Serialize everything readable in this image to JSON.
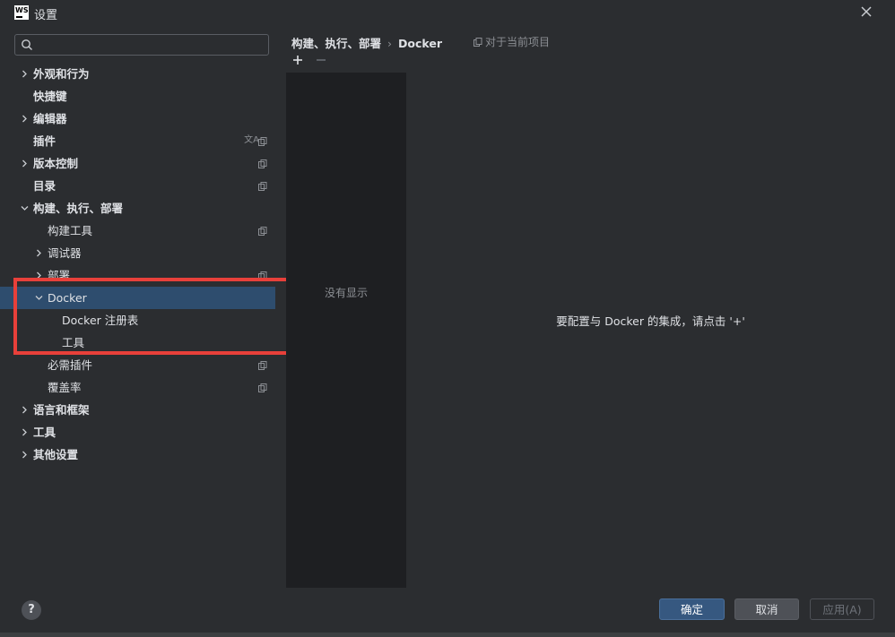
{
  "window": {
    "title": "设置",
    "logo_text": "WS"
  },
  "search": {
    "placeholder": "",
    "value": ""
  },
  "tree": [
    {
      "label": "外观和行为",
      "bold": true,
      "chevron": "right",
      "indent": 0,
      "icons": []
    },
    {
      "label": "快捷键",
      "bold": true,
      "chevron": "none",
      "indent": 0,
      "icons": []
    },
    {
      "label": "编辑器",
      "bold": true,
      "chevron": "right",
      "indent": 0,
      "icons": []
    },
    {
      "label": "插件",
      "bold": true,
      "chevron": "none",
      "indent": 0,
      "icons": [
        "translate",
        "copy"
      ]
    },
    {
      "label": "版本控制",
      "bold": true,
      "chevron": "right",
      "indent": 0,
      "icons": [
        "copy"
      ]
    },
    {
      "label": "目录",
      "bold": true,
      "chevron": "none",
      "indent": 0,
      "icons": [
        "copy"
      ]
    },
    {
      "label": "构建、执行、部署",
      "bold": true,
      "chevron": "down",
      "indent": 0,
      "icons": []
    },
    {
      "label": "构建工具",
      "bold": false,
      "chevron": "none",
      "indent": 1,
      "icons": [
        "copy"
      ]
    },
    {
      "label": "调试器",
      "bold": false,
      "chevron": "right",
      "indent": 1,
      "icons": []
    },
    {
      "label": "部署",
      "bold": false,
      "chevron": "right",
      "indent": 1,
      "icons": [
        "copy"
      ]
    },
    {
      "label": "Docker",
      "bold": false,
      "chevron": "down",
      "indent": 1,
      "icons": [],
      "selected": true
    },
    {
      "label": "Docker 注册表",
      "bold": false,
      "chevron": "none",
      "indent": 2,
      "icons": []
    },
    {
      "label": "工具",
      "bold": false,
      "chevron": "none",
      "indent": 2,
      "icons": []
    },
    {
      "label": "必需插件",
      "bold": false,
      "chevron": "none",
      "indent": 1,
      "icons": [
        "copy"
      ]
    },
    {
      "label": "覆盖率",
      "bold": false,
      "chevron": "none",
      "indent": 1,
      "icons": [
        "copy"
      ]
    },
    {
      "label": "语言和框架",
      "bold": true,
      "chevron": "right",
      "indent": 0,
      "icons": []
    },
    {
      "label": "工具",
      "bold": true,
      "chevron": "right",
      "indent": 0,
      "icons": []
    },
    {
      "label": "其他设置",
      "bold": true,
      "chevron": "right",
      "indent": 0,
      "icons": []
    }
  ],
  "content": {
    "breadcrumb": [
      "构建、执行、部署",
      "Docker"
    ],
    "breadcrumb_separator": "›",
    "scope_label": "对于当前项目",
    "list_empty_text": "没有显示",
    "detail_message": "要配置与 Docker 的集成，请点击 '+'"
  },
  "footer": {
    "help_label": "?",
    "ok_label": "确定",
    "cancel_label": "取消",
    "apply_label": "应用(A)"
  },
  "colors": {
    "background": "#2b2d30",
    "selection": "#2e4d6e",
    "highlight_border": "#e8403a",
    "primary_button": "#365880",
    "list_panel": "#1e1f22"
  }
}
